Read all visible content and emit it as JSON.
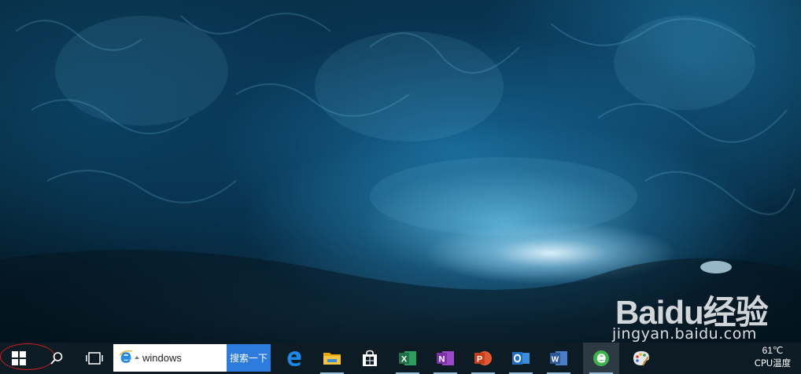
{
  "desktop": {
    "wallpaper": "ice-cave",
    "watermark": {
      "logo_text": "Baidu经验",
      "url_text": "jingyan.baidu.com"
    }
  },
  "taskbar": {
    "background": "#0c1b24",
    "start_icon": "windows-logo-icon",
    "search_icon": "magnifier-icon",
    "task_view_icon": "task-view-icon",
    "search": {
      "value": "windows",
      "button_label": "搜索一下",
      "button_color": "#2d7bdc"
    },
    "apps": [
      {
        "name": "edge",
        "icon": "edge-icon",
        "color": "#1e86e3",
        "running": false
      },
      {
        "name": "file-explorer",
        "icon": "folder-icon",
        "color": "#f5c542",
        "running": true
      },
      {
        "name": "store",
        "icon": "store-bag-icon",
        "color": "#ffffff",
        "running": false
      },
      {
        "name": "excel",
        "icon": "excel-icon",
        "color": "#1e7145",
        "running": true
      },
      {
        "name": "onenote",
        "icon": "onenote-icon",
        "color": "#7d2fa8",
        "running": true
      },
      {
        "name": "powerpoint",
        "icon": "powerpoint-icon",
        "color": "#d04423",
        "running": true
      },
      {
        "name": "outlook",
        "icon": "outlook-icon",
        "color": "#1f6fc5",
        "running": true
      },
      {
        "name": "word",
        "icon": "word-icon",
        "color": "#2b5797",
        "running": true
      },
      {
        "name": "360-browser",
        "icon": "green-browser-icon",
        "color": "#3bb34a",
        "running": true,
        "active": true
      },
      {
        "name": "paint",
        "icon": "paint-palette-icon",
        "color": "#e8e8e8",
        "running": false
      }
    ],
    "tray": {
      "temperature": "61℃",
      "label": "CPU温度"
    }
  }
}
